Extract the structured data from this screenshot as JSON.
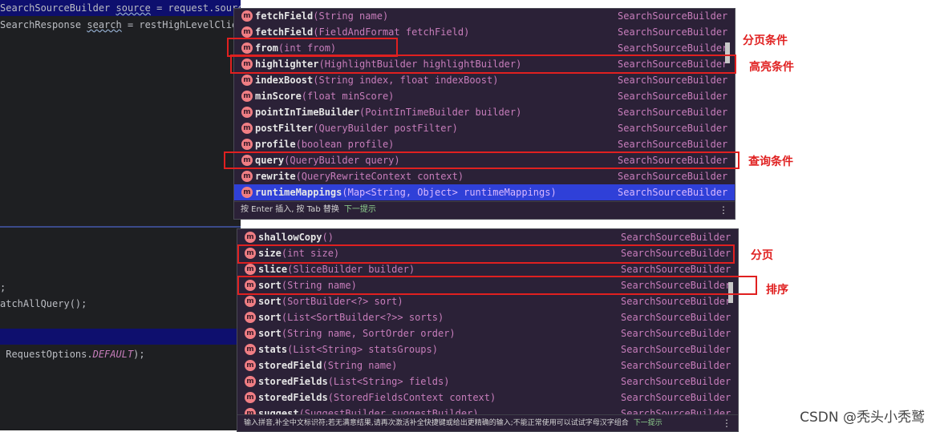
{
  "editor": {
    "lines": [
      {
        "pre": "SearchSourceBuilder ",
        "var": "source",
        "post": " = request.source()."
      },
      {
        "pre": "SearchResponse ",
        "var": "search",
        "post": " = restHighLevelClien"
      },
      {
        "pre": ";",
        "var": "",
        "post": ""
      },
      {
        "pre": "atchAllQuery();",
        "var": "",
        "post": ""
      },
      {
        "pre": " RequestOptions.",
        "var": "",
        "post": ""
      }
    ],
    "default_const": "DEFAULT",
    "default_tail": ");"
  },
  "popup1": {
    "items": [
      {
        "name": "fetchField",
        "sig": "(String name)",
        "type": "SearchSourceBuilder"
      },
      {
        "name": "fetchField",
        "sig": "(FieldAndFormat fetchField)",
        "type": "SearchSourceBuilder"
      },
      {
        "name": "from",
        "sig": "(int from)",
        "type": "SearchSourceBuilder"
      },
      {
        "name": "highlighter",
        "sig": "(HighlightBuilder highlightBuilder)",
        "type": "SearchSourceBuilder"
      },
      {
        "name": "indexBoost",
        "sig": "(String index, float indexBoost)",
        "type": "SearchSourceBuilder"
      },
      {
        "name": "minScore",
        "sig": "(float minScore)",
        "type": "SearchSourceBuilder"
      },
      {
        "name": "pointInTimeBuilder",
        "sig": "(PointInTimeBuilder builder)",
        "type": "SearchSourceBuilder"
      },
      {
        "name": "postFilter",
        "sig": "(QueryBuilder postFilter)",
        "type": "SearchSourceBuilder"
      },
      {
        "name": "profile",
        "sig": "(boolean profile)",
        "type": "SearchSourceBuilder"
      },
      {
        "name": "query",
        "sig": "(QueryBuilder query)",
        "type": "SearchSourceBuilder"
      },
      {
        "name": "rewrite",
        "sig": "(QueryRewriteContext context)",
        "type": "SearchSourceBuilder"
      },
      {
        "name": "runtimeMappings",
        "sig": "(Map<String, Object> runtimeMappings)",
        "type": "SearchSourceBuilder",
        "selected": true
      }
    ],
    "hint": "按 Enter 插入, 按 Tab 替换",
    "hint_next": "下一提示"
  },
  "popup2": {
    "items": [
      {
        "name": "shallowCopy",
        "sig": "()",
        "type": "SearchSourceBuilder"
      },
      {
        "name": "size",
        "sig": "(int size)",
        "type": "SearchSourceBuilder"
      },
      {
        "name": "slice",
        "sig": "(SliceBuilder builder)",
        "type": "SearchSourceBuilder"
      },
      {
        "name": "sort",
        "sig": "(String name)",
        "type": "SearchSourceBuilder"
      },
      {
        "name": "sort",
        "sig": "(SortBuilder<?> sort)",
        "type": "SearchSourceBuilder"
      },
      {
        "name": "sort",
        "sig": "(List<SortBuilder<?>> sorts)",
        "type": "SearchSourceBuilder"
      },
      {
        "name": "sort",
        "sig": "(String name, SortOrder order)",
        "type": "SearchSourceBuilder"
      },
      {
        "name": "stats",
        "sig": "(List<String> statsGroups)",
        "type": "SearchSourceBuilder"
      },
      {
        "name": "storedField",
        "sig": "(String name)",
        "type": "SearchSourceBuilder"
      },
      {
        "name": "storedFields",
        "sig": "(List<String> fields)",
        "type": "SearchSourceBuilder"
      },
      {
        "name": "storedFields",
        "sig": "(StoredFieldsContext context)",
        "type": "SearchSourceBuilder"
      },
      {
        "name": "suggest",
        "sig": "(SuggestBuilder suggestBuilder)",
        "type": "SearchSourceBuilder"
      }
    ],
    "hint": "输入拼音,补全中文标识符;若无满意结果,请再次激活补全快捷键或给出更精确的输入;不能正常使用可以试试字母汉字组合",
    "hint_next": "下一提示"
  },
  "method_icon": "m",
  "annotations": {
    "paging_condition": "分页条件",
    "highlight_condition": "高亮条件",
    "query_condition": "查询条件",
    "paging": "分页",
    "sorting": "排序"
  },
  "watermark": "CSDN @秃头小秃鹫",
  "colors": {
    "annotation_red": "#e02020",
    "selected_row": "#2f40d8",
    "method_icon": "#f07e84"
  }
}
